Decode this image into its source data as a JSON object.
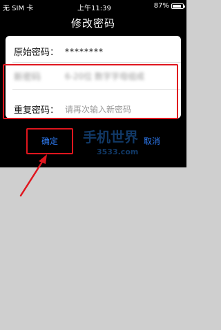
{
  "status_bar": {
    "carrier": "无 SIM 卡",
    "time": "上午11:39",
    "battery_text": "87%",
    "battery_level": 0.87
  },
  "header": {
    "title": "修改密码"
  },
  "form": {
    "original_label": "原始密码：",
    "original_value": "********",
    "new_label": "新密码",
    "new_placeholder": "6-20位 数字字母组成",
    "repeat_label": "重复密码：",
    "repeat_placeholder": "请再次输入新密码"
  },
  "buttons": {
    "confirm": "确定",
    "cancel": "取消"
  },
  "watermark": {
    "brand": "手机世界",
    "url": "3533.com"
  },
  "colors": {
    "accent": "#2e7cf6",
    "highlight": "#e0161e"
  }
}
